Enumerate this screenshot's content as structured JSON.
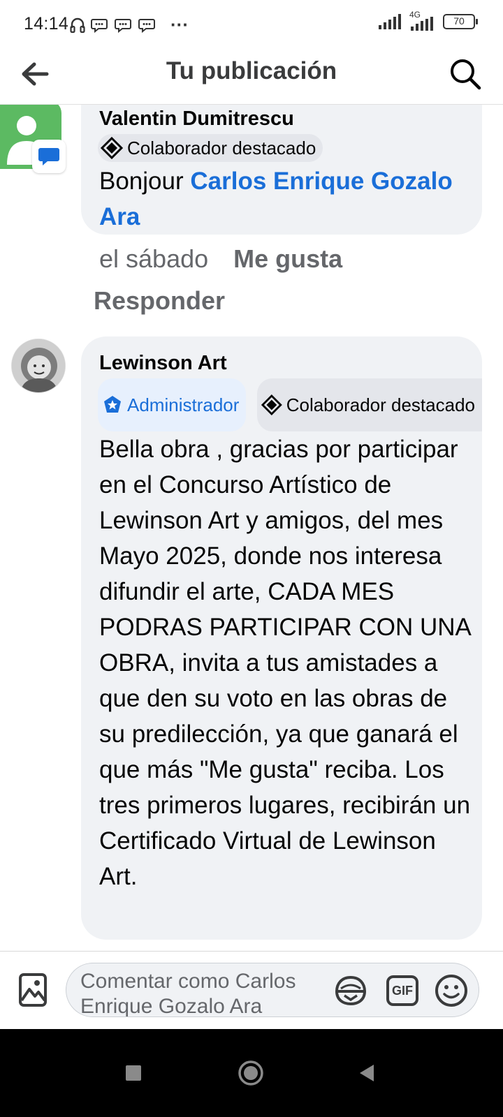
{
  "status_bar": {
    "time": "14:14",
    "network_label": "4G",
    "battery": "70",
    "more": "···"
  },
  "header": {
    "title": "Tu publicación"
  },
  "comment1": {
    "author": "Valentin Dumitrescu",
    "badge": "Colaborador destacado",
    "text_prefix": "Bonjour ",
    "mention": "Carlos Enrique Gozalo Ara",
    "time": "el sábado",
    "like_label": "Me gusta",
    "reply_label": "Responder"
  },
  "comment2": {
    "author": "Lewinson Art",
    "badge_admin": "Administrador",
    "badge_top": "Colaborador destacado",
    "text": "Bella obra , gracias por participar en el Concurso Artístico de Lewinson Art y amigos, del mes Mayo 2025, donde nos interesa difundir el arte, CADA MES PODRAS PARTICIPAR CON UNA OBRA, invita a tus amistades a que den su voto  en las obras de su predilección, ya que ganará el que más \"Me gusta\" reciba. Los tres primeros lugares, recibirán un Certificado Virtual de Lewinson Art."
  },
  "composer": {
    "placeholder": "Comentar como Carlos Enrique Gozalo Ara",
    "gif_label": "GIF"
  },
  "colors": {
    "link": "#1a6ed8",
    "bubble": "#f0f2f5",
    "secondary_text": "#65676b",
    "avatar_green": "#5cba62"
  },
  "icons": [
    "back-arrow-icon",
    "search-icon",
    "photo-icon",
    "avatar-sticker-icon",
    "gif-icon",
    "emoji-icon",
    "chat-bubble-icon",
    "shield-star-icon",
    "diamond-badge-icon",
    "recent-apps-icon",
    "home-icon",
    "back-nav-icon"
  ]
}
